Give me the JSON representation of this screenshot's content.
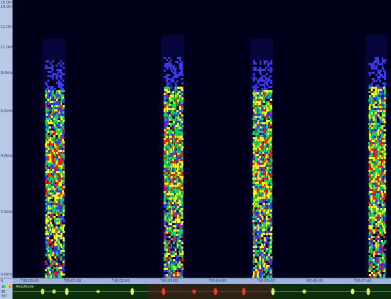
{
  "frequency_axis": {
    "top_labels": [
      "16.0kHz",
      "14.0kHz"
    ],
    "ticks": [
      "12.0kHz",
      "11.0kHz",
      "8.0kHz",
      "6.0kHz",
      "4.0kHz",
      "2.0kHz",
      "0.0kHz"
    ]
  },
  "time_axis": {
    "ticks": [
      "00:00:00",
      "00:01:00",
      "00:02:00",
      "00:03:00",
      "00:04:00",
      "00:05:00",
      "00:06:00",
      "00:07:00"
    ]
  },
  "waveform": {
    "amplitude_label": "Amplitude",
    "scale_labels": [
      "dB",
      "-inf"
    ]
  },
  "colors": {
    "background": "#00001a",
    "low": "#3a3aff",
    "mid": "#00e060",
    "high": "#ffff00",
    "peak": "#ff2000"
  }
}
